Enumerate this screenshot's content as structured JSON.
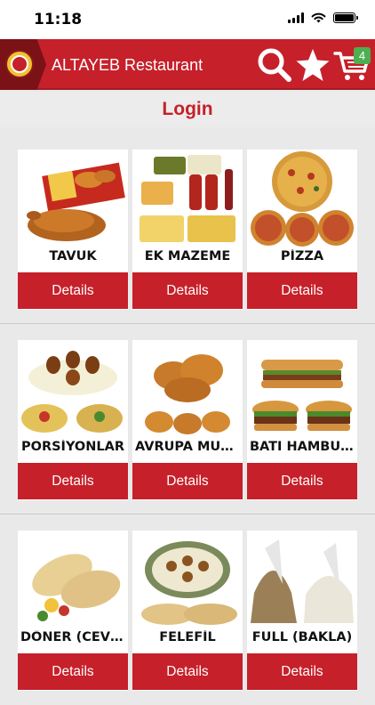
{
  "status": {
    "time": "11:18"
  },
  "header": {
    "title": "ALTAYEB Restaurant",
    "cart_count": "4"
  },
  "login": {
    "label": "Login"
  },
  "categories": [
    {
      "name": "TAVUK",
      "button": "Details"
    },
    {
      "name": "EK MAZEME",
      "button": "Details"
    },
    {
      "name": "PİZZA",
      "button": "Details"
    },
    {
      "name": "PORSİYONLAR",
      "button": "Details"
    },
    {
      "name": "AVRUPA MUT...",
      "button": "Details"
    },
    {
      "name": "BATI HAMBUR...",
      "button": "Details"
    },
    {
      "name": "DÖNER (CEVİ...",
      "button": "Details"
    },
    {
      "name": "FELEFİL",
      "button": "Details"
    },
    {
      "name": "FULL (BAKLA)",
      "button": "Details"
    }
  ],
  "colors": {
    "brand_red": "#c6202a",
    "badge_green": "#4caf50",
    "background": "#e9e9e9"
  }
}
